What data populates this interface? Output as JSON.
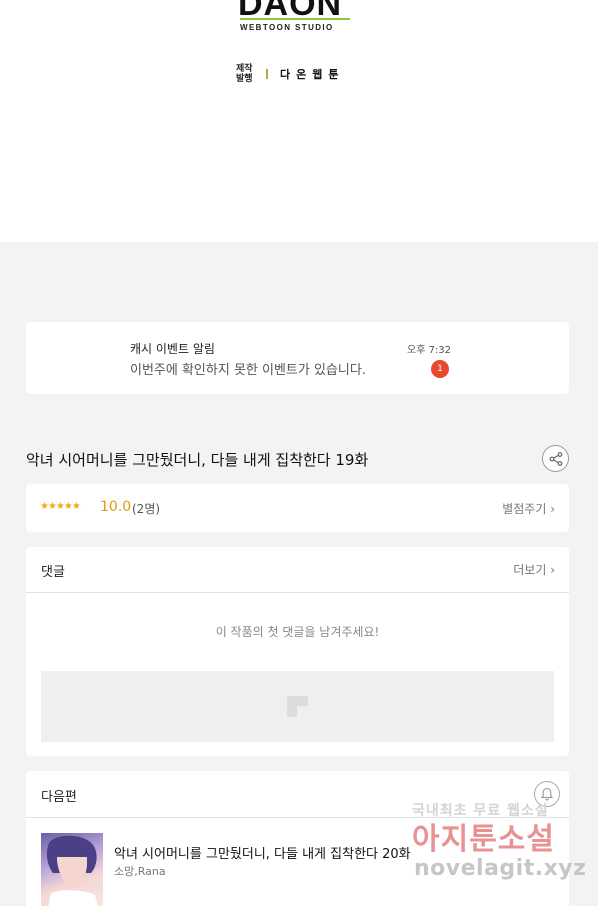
{
  "branding": {
    "logo_text": "DAON",
    "logo_sub": "WEBTOON STUDIO",
    "credit_label": "제작\n발행",
    "credit_name": "다온웹툰"
  },
  "notification": {
    "title": "캐시 이벤트 알림",
    "message": "이번주에 확인하지 못한 이벤트가 있습니다.",
    "time": "오후 7:32",
    "badge_count": "1"
  },
  "episode": {
    "title": "악녀 시어머니를 그만뒀더니, 다들 내게 집착한다 19화"
  },
  "rating": {
    "stars": "★★★★★",
    "score": "10.0",
    "voters": "(2명)",
    "rate_label": "별점주기 ›"
  },
  "comments": {
    "title": "댓글",
    "more_label": "더보기 ›",
    "empty_message": "이 작품의 첫 댓글을 남겨주세요!"
  },
  "next_episode": {
    "section_title": "다음편",
    "title": "악녀 시어머니를 그만뒀더니, 다들 내게 집착한다 20화",
    "author": "소망,Rana"
  },
  "watermark": {
    "line1": "국내최초 무료 웹소설",
    "line2": "아지툰소설",
    "line3": "novelagit.xyz"
  },
  "colors": {
    "accent_orange": "#e39a12",
    "badge_red": "#e8492f",
    "logo_green": "#8dc63f"
  }
}
